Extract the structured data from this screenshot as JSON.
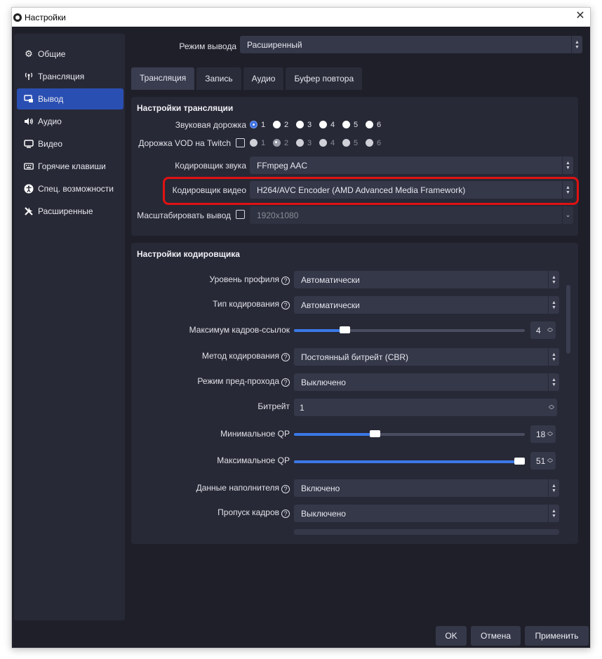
{
  "window": {
    "title": "Настройки"
  },
  "sidebar": {
    "items": [
      {
        "label": "Общие",
        "icon": "gear-icon"
      },
      {
        "label": "Трансляция",
        "icon": "broadcast-icon"
      },
      {
        "label": "Вывод",
        "icon": "output-icon",
        "active": true
      },
      {
        "label": "Аудио",
        "icon": "speaker-icon"
      },
      {
        "label": "Видео",
        "icon": "monitor-icon"
      },
      {
        "label": "Горячие клавиши",
        "icon": "keyboard-icon"
      },
      {
        "label": "Спец. возможности",
        "icon": "accessibility-icon"
      },
      {
        "label": "Расширенные",
        "icon": "tools-icon"
      }
    ]
  },
  "output_mode": {
    "label": "Режим вывода",
    "value": "Расширенный"
  },
  "tabs": [
    "Трансляция",
    "Запись",
    "Аудио",
    "Буфер повтора"
  ],
  "stream_settings": {
    "title": "Настройки трансляции",
    "audio_track": {
      "label": "Звуковая дорожка",
      "options": [
        "1",
        "2",
        "3",
        "4",
        "5",
        "6"
      ],
      "selected": "1"
    },
    "vod_track": {
      "label": "Дорожка VOD на Twitch",
      "options": [
        "1",
        "2",
        "3",
        "4",
        "5",
        "6"
      ],
      "selected": "2"
    },
    "audio_encoder": {
      "label": "Кодировщик звука",
      "value": "FFmpeg AAC"
    },
    "video_encoder": {
      "label": "Кодировщик видео",
      "value": "H264/AVC Encoder (AMD Advanced Media Framework)"
    },
    "rescale": {
      "label": "Масштабировать вывод",
      "value": "1920x1080"
    }
  },
  "encoder_settings": {
    "title": "Настройки кодировщика",
    "profile_level": {
      "label": "Уровень профиля",
      "value": "Автоматически"
    },
    "coding_type": {
      "label": "Тип кодирования",
      "value": "Автоматически"
    },
    "max_ref_frames": {
      "label": "Максимум кадров-ссылок",
      "value": "4",
      "fraction": 0.22
    },
    "rate_control": {
      "label": "Метод кодирования",
      "value": "Постоянный битрейт (CBR)"
    },
    "prepass": {
      "label": "Режим пред-прохода",
      "value": "Выключено"
    },
    "bitrate": {
      "label": "Битрейт",
      "value": "1"
    },
    "min_qp": {
      "label": "Минимальное QP",
      "value": "18",
      "fraction": 0.35
    },
    "max_qp": {
      "label": "Максимальное QP",
      "value": "51",
      "fraction": 1.0
    },
    "filler_data": {
      "label": "Данные наполнителя",
      "value": "Включено"
    },
    "frame_skipping": {
      "label": "Пропуск кадров",
      "value": "Выключено"
    }
  },
  "buttons": {
    "ok": "OK",
    "cancel": "Отмена",
    "apply": "Применить"
  },
  "help_glyph": "?",
  "colors": {
    "accent": "#2a4fb3",
    "highlight": "#e01212",
    "background": "#1e1f29"
  }
}
